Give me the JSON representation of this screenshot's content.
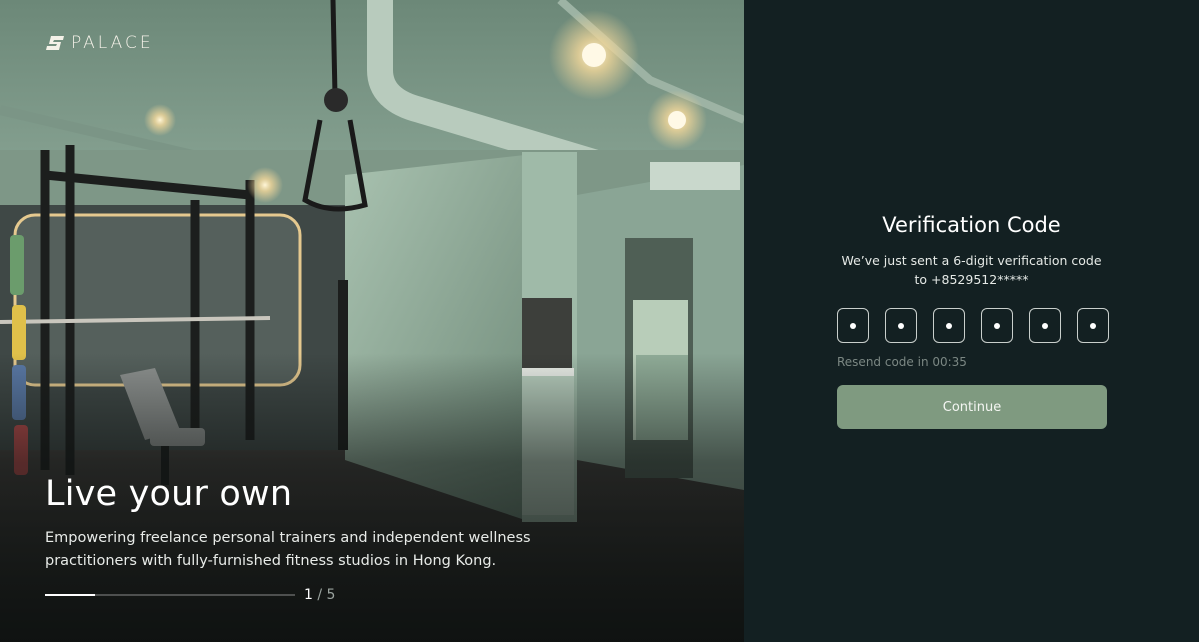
{
  "brand": {
    "name": "PALACE",
    "logo_icon": "palace-logo-mark"
  },
  "hero": {
    "title": "Live your own",
    "subtitle": "Empowering freelance personal trainers and independent wellness practitioners with fully-furnished fitness studios in Hong Kong.",
    "slide_current": "1",
    "slide_separator": "/",
    "slide_total": "5",
    "progress_fraction": 0.2
  },
  "verification": {
    "title": "Verification Code",
    "description_line1": "We’ve just sent a 6-digit verification code",
    "description_line2": "to  +8529512*****",
    "code_digits": [
      "•",
      "•",
      "•",
      "•",
      "•",
      "•"
    ],
    "resend_text": "Resend code in 00:35",
    "continue_label": "Continue"
  },
  "colors": {
    "panel_bg": "#132022",
    "accent_button": "#7f9a80",
    "studio_wall": "#8fa897"
  }
}
